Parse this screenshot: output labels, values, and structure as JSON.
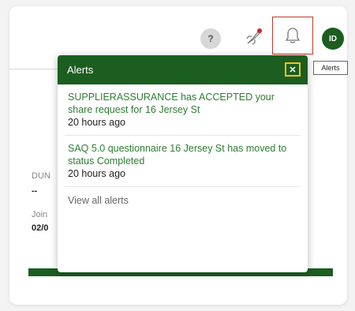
{
  "header": {
    "help_label": "?",
    "avatar_initials": "ID",
    "tooltip": "Alerts"
  },
  "background": {
    "label_1": "DUN",
    "value_1": "--",
    "label_2": "Join",
    "value_2": "02/0"
  },
  "alerts_popup": {
    "title": "Alerts",
    "close_label": "✕",
    "items": [
      {
        "message": "SUPPLIERASSURANCE has ACCEPTED your share request for 16 Jersey St",
        "time": "20 hours ago"
      },
      {
        "message": "SAQ 5.0 questionnaire 16 Jersey St has moved to status Completed",
        "time": "20 hours ago"
      }
    ],
    "view_all": "View all alerts"
  },
  "colors": {
    "brand_green": "#1b5e20",
    "link_green": "#2e7d32",
    "highlight_red": "#c0392b",
    "focus_yellow": "#f0c419"
  },
  "icons": [
    "help-icon",
    "rocket-icon",
    "bell-icon",
    "close-icon"
  ]
}
